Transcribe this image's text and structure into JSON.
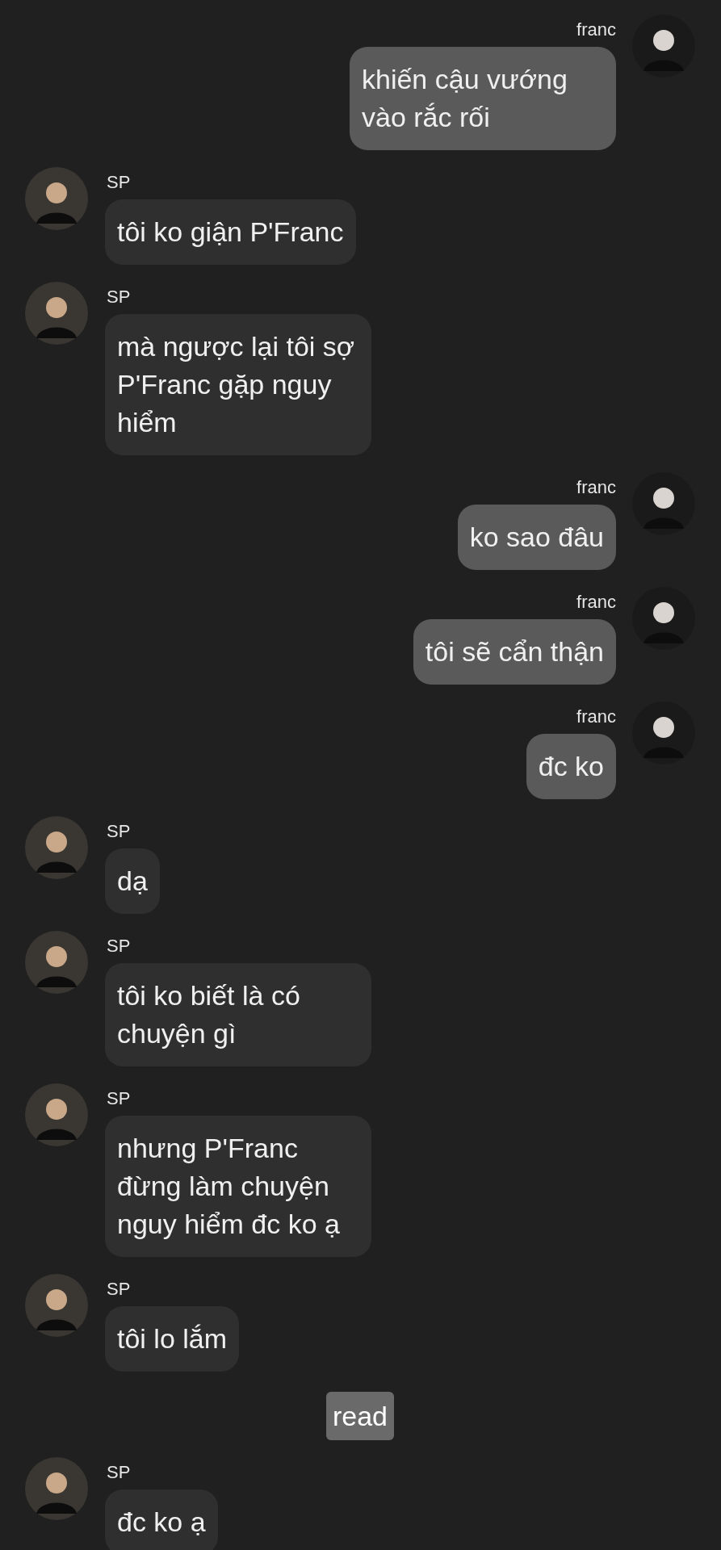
{
  "messages": [
    {
      "kind": "outgoing",
      "sender": "franc",
      "text": "khiến cậu vướng vào rắc rối"
    },
    {
      "kind": "incoming",
      "sender": "SP",
      "text": "tôi ko giận P'Franc"
    },
    {
      "kind": "incoming",
      "sender": "SP",
      "text": "mà ngược lại tôi sợ P'Franc gặp nguy hiểm"
    },
    {
      "kind": "outgoing",
      "sender": "franc",
      "text": "ko sao đâu"
    },
    {
      "kind": "outgoing",
      "sender": "franc",
      "text": "tôi sẽ cẩn thận"
    },
    {
      "kind": "outgoing",
      "sender": "franc",
      "text": "đc ko"
    },
    {
      "kind": "incoming",
      "sender": "SP",
      "text": "dạ"
    },
    {
      "kind": "incoming",
      "sender": "SP",
      "text": "tôi ko biết là có chuyện gì"
    },
    {
      "kind": "incoming",
      "sender": "SP",
      "text": "nhưng P'Franc đừng làm chuyện nguy hiểm đc ko ạ"
    },
    {
      "kind": "incoming",
      "sender": "SP",
      "text": "tôi lo lắm"
    },
    {
      "kind": "status",
      "text": "read"
    },
    {
      "kind": "incoming",
      "sender": "SP",
      "text": "đc ko ạ"
    }
  ]
}
